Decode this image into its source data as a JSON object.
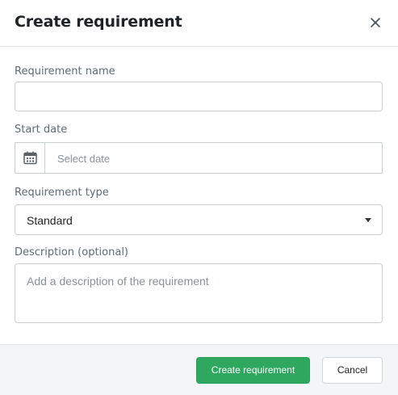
{
  "dialog": {
    "title": "Create requirement",
    "close_icon": "close-icon"
  },
  "form": {
    "name": {
      "label": "Requirement name",
      "value": ""
    },
    "start_date": {
      "label": "Start date",
      "placeholder": "Select date",
      "icon": "calendar-icon"
    },
    "type": {
      "label": "Requirement type",
      "selected": "Standard",
      "icon": "caret-down-icon"
    },
    "description": {
      "label": "Description (optional)",
      "placeholder": "Add a description of the requirement"
    }
  },
  "footer": {
    "create_label": "Create requirement",
    "cancel_label": "Cancel"
  },
  "colors": {
    "primary": "#2ea85f",
    "border": "#c9ced2",
    "label": "#5f6b73",
    "footer_bg": "#f4f5f7"
  }
}
